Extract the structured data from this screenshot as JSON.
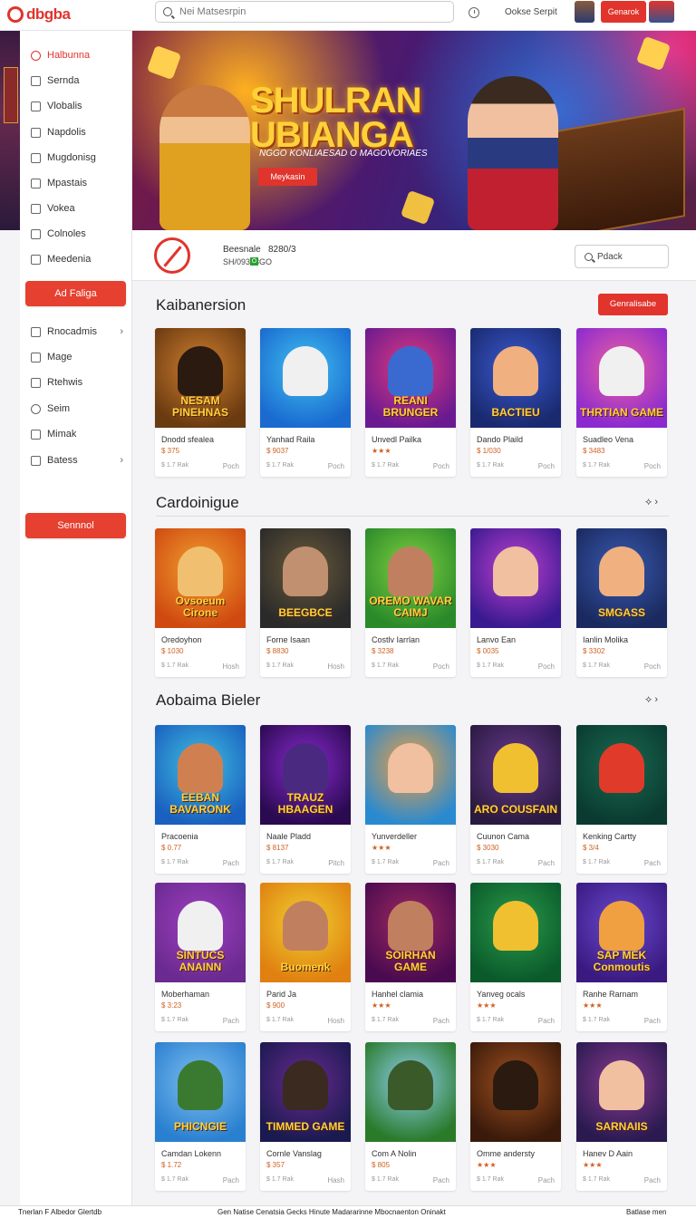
{
  "header": {
    "logo": "dbgba",
    "search_placeholder": "Nei Matsesrpin",
    "links": "Ookse  Serpit",
    "cta_label": "Genarok"
  },
  "sidebar": {
    "items": [
      {
        "label": "Halbunna",
        "icon": "home-icon",
        "active": true
      },
      {
        "label": "Sernda",
        "icon": "square-icon"
      },
      {
        "label": "Vlobalis",
        "icon": "shield-icon"
      },
      {
        "label": "Napdolis",
        "icon": "square-icon"
      },
      {
        "label": "Mugdonisg",
        "icon": "square-icon"
      },
      {
        "label": "Mpastais",
        "icon": "grid-icon"
      },
      {
        "label": "Vokea",
        "icon": "check-icon"
      },
      {
        "label": "Colnoles",
        "icon": "gear-icon"
      },
      {
        "label": "Meedenia",
        "icon": "doc-icon"
      }
    ],
    "button_top": "Ad Faliga",
    "items2": [
      {
        "label": "Rnocadmis",
        "icon": "grid-icon",
        "chevron": true
      },
      {
        "label": "Mage",
        "icon": "shield-icon"
      },
      {
        "label": "Rtehwis",
        "icon": "square-icon"
      },
      {
        "label": "Seim",
        "icon": "chat-icon"
      },
      {
        "label": "Mimak",
        "icon": "check-icon"
      },
      {
        "label": "Batess",
        "icon": "box-icon",
        "chevron": true
      }
    ],
    "button_bottom": "Sennnol"
  },
  "banner": {
    "title": "SHULRAN UBIANGA",
    "subtitle": "NGGO KONLIAESAD O MAGOVORIAES",
    "button": "Meykasin"
  },
  "profile": {
    "name": "Beesnale",
    "count": "8280/3",
    "id": "SH/09373GO",
    "badge": "O",
    "search_label": "Pdack"
  },
  "sections": [
    {
      "title": "Kaibanersion",
      "action": "Genralisabe",
      "cards": [
        {
          "title": "Dnodd sfealea",
          "meta": "$ 375",
          "stat": "$ 1.7 Rak",
          "action": "Poch",
          "art": "NESAM PINEHNAS",
          "bg1": "#6a3a10",
          "bg2": "#d08030",
          "art_color": "#2a1a10"
        },
        {
          "title": "Yanhad Raila",
          "meta": "$ 9037",
          "stat": "$ 1.7 Rak",
          "action": "Poch",
          "art": "",
          "bg1": "#1a6ad0",
          "bg2": "#40c0f0",
          "art_color": "#f0f0f0"
        },
        {
          "title": "Unvedl Pailka",
          "meta": "★★★",
          "stat": "$ 1.7 Rak",
          "action": "Poch",
          "art": "REANI BRUNGER",
          "bg1": "#6a1a90",
          "bg2": "#e03a80",
          "art_color": "#3a6ad0"
        },
        {
          "title": "Dando Plaild",
          "meta": "$ 1/030",
          "stat": "$ 1.7 Rak",
          "action": "Poch",
          "art": "BACTIEU",
          "bg1": "#1a2a70",
          "bg2": "#3a5ad0",
          "art_color": "#f0b080"
        },
        {
          "title": "Suadleo Vena",
          "meta": "$ 3483",
          "stat": "$ 1.7 Rak",
          "action": "Poch",
          "art": "THRTIAN GAME",
          "bg1": "#8a2ad0",
          "bg2": "#f060a0",
          "art_color": "#f0f0f0"
        }
      ]
    },
    {
      "title": "Cardoinigue",
      "cards": [
        {
          "title": "Oredoyhon",
          "meta": "$ 1030",
          "stat": "$ 1.7 Rak",
          "action": "Hosh",
          "art": "Ovsoeum Cirone",
          "bg1": "#d04a10",
          "bg2": "#f0a030",
          "art_color": "#f0c070"
        },
        {
          "title": "Forne Isaan",
          "meta": "$ 8830",
          "stat": "$ 1.7 Rak",
          "action": "Hosh",
          "art": "BEEGBCE",
          "bg1": "#2a2a2a",
          "bg2": "#6a5a3a",
          "art_color": "#c09070"
        },
        {
          "title": "Costlv Iarrlan",
          "meta": "$ 3238",
          "stat": "$ 1.7 Rak",
          "action": "Poch",
          "art": "OREMO WAVAR CAIMJ",
          "bg1": "#2a8a2a",
          "bg2": "#80d040",
          "art_color": "#c08060"
        },
        {
          "title": "Lanvo Ean",
          "meta": "$ 0035",
          "stat": "$ 1.7 Rak",
          "action": "Poch",
          "art": "",
          "bg1": "#3a1a90",
          "bg2": "#c040d0",
          "art_color": "#f0c0a0"
        },
        {
          "title": "Ianlin Molika",
          "meta": "$ 3302",
          "stat": "$ 1.7 Rak",
          "action": "Poch",
          "art": "SMGASS",
          "bg1": "#1a2a60",
          "bg2": "#3a5ab0",
          "art_color": "#f0b080"
        }
      ]
    },
    {
      "title": "Aobaima Bieler",
      "cards": [
        {
          "title": "Pracoenia",
          "meta": "$ 0.77",
          "stat": "$ 1.7 Rak",
          "action": "Pach",
          "art": "EEBAN BAVARONK",
          "bg1": "#1a60c0",
          "bg2": "#40c0e0",
          "art_color": "#d08050"
        },
        {
          "title": "Naale Pladd",
          "meta": "$ 8137",
          "stat": "$ 1.7 Rak",
          "action": "Pitch",
          "art": "TRAUZ HBAAGEN",
          "bg1": "#2a0a50",
          "bg2": "#8a2ad0",
          "art_color": "#4a2a80"
        },
        {
          "title": "Yunverdeller",
          "meta": "★★★",
          "stat": "$ 1.7 Rak",
          "action": "Pach",
          "art": "",
          "bg1": "#2a8ad0",
          "bg2": "#f0a040",
          "art_color": "#f0c0a0"
        },
        {
          "title": "Cuunon Cama",
          "meta": "$ 3030",
          "stat": "$ 1.7 Rak",
          "action": "Pach",
          "art": "ARO COUSFAIN",
          "bg1": "#2a1a40",
          "bg2": "#6a3a90",
          "art_color": "#f0c030"
        },
        {
          "title": "Kenking Cartty",
          "meta": "$ 3/4",
          "stat": "$ 1.7 Rak",
          "action": "Pach",
          "art": "",
          "bg1": "#0a3a30",
          "bg2": "#1a6a50",
          "art_color": "#e03a2a"
        }
      ]
    },
    {
      "title": "",
      "cards": [
        {
          "title": "Moberhaman",
          "meta": "$ 3:23",
          "stat": "$ 1.7 Rak",
          "action": "Pach",
          "art": "SINTUCS ANAINN",
          "bg1": "#6a2a90",
          "bg2": "#a040c0",
          "art_color": "#f0f0f0"
        },
        {
          "title": "Parid Ja",
          "meta": "$ 900",
          "stat": "$ 1.7 Rak",
          "action": "Hosh",
          "art": "Buomenk",
          "bg1": "#e08010",
          "bg2": "#f0d030",
          "art_color": "#c08060"
        },
        {
          "title": "Hanhel clamia",
          "meta": "★★★",
          "stat": "$ 1.7 Rak",
          "action": "Pach",
          "art": "SOIRHAN GAME",
          "bg1": "#4a0a50",
          "bg2": "#a02a60",
          "art_color": "#c08060"
        },
        {
          "title": "Yanveg ocals",
          "meta": "★★★",
          "stat": "$ 1.7 Rak",
          "action": "Pach",
          "art": "",
          "bg1": "#0a5a2a",
          "bg2": "#2a9a4a",
          "art_color": "#f0c030"
        },
        {
          "title": "Ranhe Rarnam",
          "meta": "★★★",
          "stat": "$ 1.7 Rak",
          "action": "Pach",
          "art": "SAP MEK Conmoutis",
          "bg1": "#3a1a80",
          "bg2": "#6a4ad0",
          "art_color": "#f0a040"
        }
      ]
    },
    {
      "title": "",
      "cards": [
        {
          "title": "Camdan Lokenn",
          "meta": "$ 1.72",
          "stat": "$ 1.7 Rak",
          "action": "Pach",
          "art": "PHICNGIE",
          "bg1": "#2a80d0",
          "bg2": "#80c0f0",
          "art_color": "#3a7a30"
        },
        {
          "title": "Cornle Vanslag",
          "meta": "$ 357",
          "stat": "$ 1.7 Rak",
          "action": "Hash",
          "art": "TIMMED GAME",
          "bg1": "#1a1a50",
          "bg2": "#6a2a90",
          "art_color": "#3a2a20"
        },
        {
          "title": "Com A Nolin",
          "meta": "$ 805",
          "stat": "$ 1.7 Rak",
          "action": "Pach",
          "art": "",
          "bg1": "#2a7a2a",
          "bg2": "#90d0f0",
          "art_color": "#3a5a2a"
        },
        {
          "title": "Omme andersty",
          "meta": "★★★",
          "stat": "$ 1.7 Rak",
          "action": "Pach",
          "art": "",
          "bg1": "#3a1a0a",
          "bg2": "#a05020",
          "art_color": "#2a1a10"
        },
        {
          "title": "Hanev D Aain",
          "meta": "★★★",
          "stat": "$ 1.7 Rak",
          "action": "Pach",
          "art": "SARNAIIS",
          "bg1": "#2a1a50",
          "bg2": "#8a3a90",
          "art_color": "#f0c0a0"
        }
      ]
    }
  ],
  "footer": {
    "left": "Tnerlan F Albedor  Glertdb",
    "mid": "Gen Natise Cenatsia  Gecks  Hinute  Madararinne  Mbocnaenton  Oninakt",
    "right": "Batlase men"
  },
  "colors": {
    "accent": "#e0342c"
  }
}
